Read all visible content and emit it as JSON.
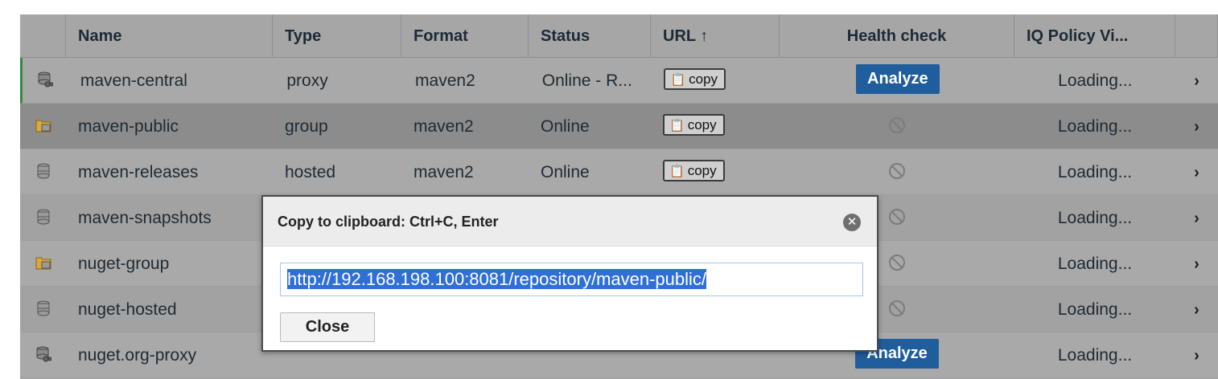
{
  "columns": [
    {
      "label": ""
    },
    {
      "label": "Name"
    },
    {
      "label": "Type"
    },
    {
      "label": "Format"
    },
    {
      "label": "Status"
    },
    {
      "label": "URL ↑"
    },
    {
      "label": "Health check"
    },
    {
      "label": "IQ Policy Vi..."
    },
    {
      "label": ""
    }
  ],
  "rows": [
    {
      "name": "maven-central",
      "type": "proxy",
      "format": "maven2",
      "status": "Online - R...",
      "url_label": "copy",
      "health": "Analyze",
      "iq": "Loading...",
      "icon": "proxy-repo-icon"
    },
    {
      "name": "maven-public",
      "type": "group",
      "format": "maven2",
      "status": "Online",
      "url_label": "copy",
      "health": "",
      "iq": "Loading...",
      "icon": "group-repo-icon"
    },
    {
      "name": "maven-releases",
      "type": "hosted",
      "format": "maven2",
      "status": "Online",
      "url_label": "copy",
      "health": "",
      "iq": "Loading...",
      "icon": "hosted-repo-icon"
    },
    {
      "name": "maven-snapshots",
      "type": "",
      "format": "",
      "status": "",
      "url_label": "",
      "health": "",
      "iq": "Loading...",
      "icon": "hosted-repo-icon"
    },
    {
      "name": "nuget-group",
      "type": "",
      "format": "",
      "status": "",
      "url_label": "",
      "health": "",
      "iq": "Loading...",
      "icon": "group-repo-icon"
    },
    {
      "name": "nuget-hosted",
      "type": "",
      "format": "",
      "status": "",
      "url_label": "",
      "health": "",
      "iq": "Loading...",
      "icon": "hosted-repo-icon"
    },
    {
      "name": "nuget.org-proxy",
      "type": "",
      "format": "",
      "status": "",
      "url_label": "",
      "health": "Analyze",
      "iq": "Loading...",
      "icon": "proxy-repo-icon"
    }
  ],
  "row_arrow": "›",
  "modal": {
    "title": "Copy to clipboard: Ctrl+C, Enter",
    "url_value": "http://192.168.198.100:8081/repository/maven-public/",
    "close_label": "Close",
    "close_glyph": "✕"
  },
  "colors": {
    "accent": "#1f5d9c",
    "selection": "#2f6fd6",
    "online_marker": "#2e8a3e"
  }
}
